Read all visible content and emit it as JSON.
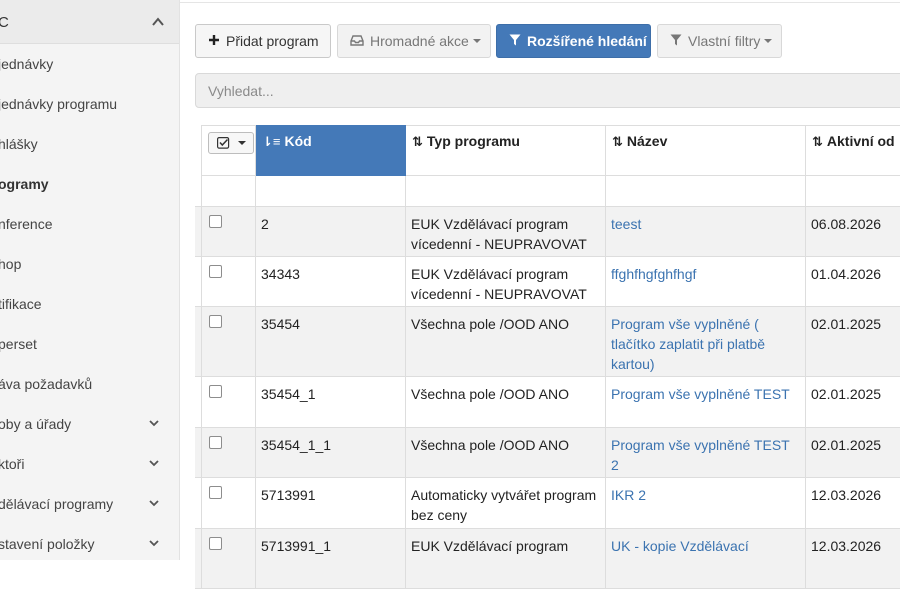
{
  "sidebar": {
    "header": "C",
    "items": [
      {
        "label": "jednávky",
        "active": false,
        "expandable": false
      },
      {
        "label": "jednávky programu",
        "active": false,
        "expandable": false
      },
      {
        "label": "hlášky",
        "active": false,
        "expandable": false
      },
      {
        "label": "ogramy",
        "active": true,
        "expandable": false
      },
      {
        "label": "nference",
        "active": false,
        "expandable": false
      },
      {
        "label": "hop",
        "active": false,
        "expandable": false
      },
      {
        "label": "tifikace",
        "active": false,
        "expandable": false
      },
      {
        "label": "perset",
        "active": false,
        "expandable": false
      },
      {
        "label": "áva požadavků",
        "active": false,
        "expandable": false
      },
      {
        "label": "oby a úřady",
        "active": false,
        "expandable": true
      },
      {
        "label": "ktoři",
        "active": false,
        "expandable": true
      },
      {
        "label": "dělávací programy",
        "active": false,
        "expandable": true
      },
      {
        "label": "stavení položky",
        "active": false,
        "expandable": true
      }
    ]
  },
  "toolbar": {
    "add_label": "Přidat program",
    "bulk_label": "Hromadné akce",
    "advanced_label": "Rozšířené hledání",
    "filters_label": "Vlastní filtry"
  },
  "search": {
    "placeholder": "Vyhledat..."
  },
  "table": {
    "headers": {
      "code": "Kód",
      "type": "Typ programu",
      "name": "Název",
      "active_from": "Aktivní od"
    },
    "sorted_column": "code",
    "rows": [
      {
        "code": "2",
        "type": "EUK Vzdělávací program vícedenní - NEUPRAVOVAT",
        "name": "teest",
        "active_from": "06.08.2026"
      },
      {
        "code": "34343",
        "type": "EUK Vzdělávací program vícedenní - NEUPRAVOVAT",
        "name": "ffghfhgfghfhgf",
        "active_from": "01.04.2026"
      },
      {
        "code": "35454",
        "type": "Všechna pole /OOD ANO",
        "name": "Program vše vyplněné ( tlačítko zaplatit při platbě kartou)",
        "active_from": "02.01.2025"
      },
      {
        "code": "35454_1",
        "type": "Všechna pole /OOD ANO",
        "name": "Program vše vyplněné TEST",
        "active_from": "02.01.2025"
      },
      {
        "code": "35454_1_1",
        "type": "Všechna pole /OOD ANO",
        "name": "Program vše vyplněné TEST 2",
        "active_from": "02.01.2025"
      },
      {
        "code": "5713991",
        "type": "Automaticky vytvářet program bez ceny",
        "name": "IKR 2",
        "active_from": "12.03.2026"
      },
      {
        "code": "5713991_1",
        "type": "EUK Vzdělávací program",
        "name": "UK - kopie Vzdělávací",
        "active_from": "12.03.2026"
      }
    ]
  },
  "colors": {
    "primary": "#4479b8",
    "link": "#3b73b0",
    "stripe": "#f2f2f2"
  }
}
